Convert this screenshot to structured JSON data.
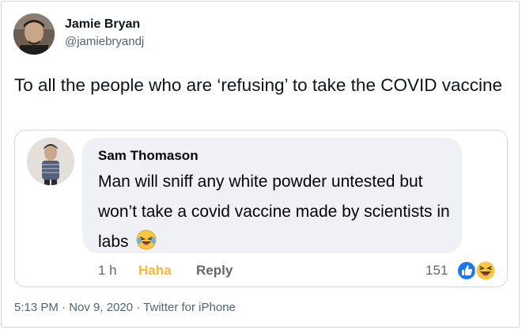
{
  "tweet": {
    "author_name": "Jamie Bryan",
    "author_handle": "@jamiebryandj",
    "text": "To all the people who are ‘refusing’ to take the COVID vaccine",
    "timestamp": "5:13 PM · Nov 9, 2020",
    "separator": " · ",
    "source": "Twitter for iPhone"
  },
  "quoted_comment": {
    "author_name": "Sam Thomason",
    "text": "Man will sniff any white powder untested but won’t take a covid vaccine made by scientists in labs",
    "emoji": "laughing-tears-emoji",
    "time": "1 h",
    "haha_label": "Haha",
    "reply_label": "Reply",
    "reaction_count": "151",
    "reactions": [
      "like-reaction-icon",
      "haha-reaction-icon"
    ]
  },
  "colors": {
    "haha_active": "#f5b83d",
    "like_blue": "#1877f2",
    "bubble": "#eff1f4",
    "muted": "#536471"
  }
}
